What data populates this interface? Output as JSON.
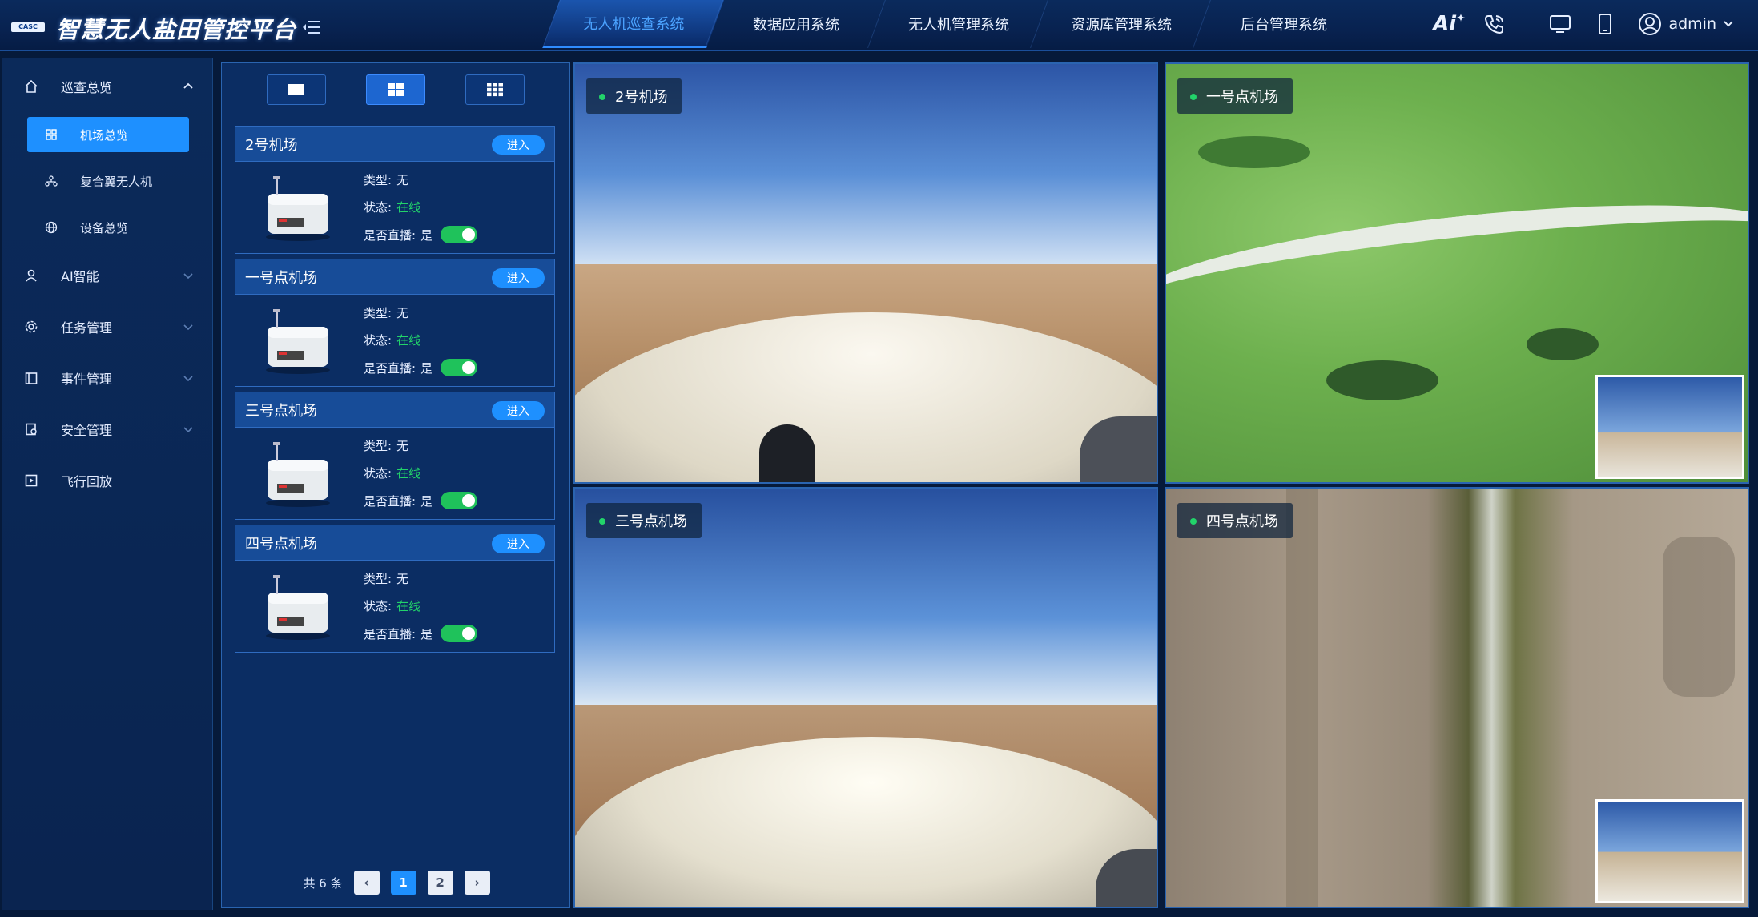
{
  "app": {
    "logo_text": "CASC",
    "title": "智慧无人盐田管控平台"
  },
  "nav": {
    "tabs": [
      {
        "label": "无人机巡查系统",
        "active": true
      },
      {
        "label": "数据应用系统",
        "active": false
      },
      {
        "label": "无人机管理系统",
        "active": false
      },
      {
        "label": "资源库管理系统",
        "active": false
      },
      {
        "label": "后台管理系统",
        "active": false
      }
    ]
  },
  "header": {
    "ai_label": "Ai",
    "user": "admin"
  },
  "sidebar": {
    "items": [
      {
        "label": "巡查总览",
        "icon": "home-icon",
        "expanded": true
      },
      {
        "label": "机场总览",
        "icon": "grid-icon",
        "active": true,
        "sub": true
      },
      {
        "label": "复合翼无人机",
        "icon": "nodes-icon",
        "sub": true
      },
      {
        "label": "设备总览",
        "icon": "globe-icon",
        "sub": true
      },
      {
        "label": "AI智能",
        "icon": "user-icon"
      },
      {
        "label": "任务管理",
        "icon": "gear-icon"
      },
      {
        "label": "事件管理",
        "icon": "calendar-icon"
      },
      {
        "label": "安全管理",
        "icon": "shield-doc-icon"
      },
      {
        "label": "飞行回放",
        "icon": "play-icon"
      }
    ]
  },
  "airports": {
    "enter_label": "进入",
    "type_label": "类型:",
    "status_label": "状态:",
    "live_label": "是否直播:",
    "list": [
      {
        "name": "2号机场",
        "type": "无",
        "status": "在线",
        "live": "是"
      },
      {
        "name": "一号点机场",
        "type": "无",
        "status": "在线",
        "live": "是"
      },
      {
        "name": "三号点机场",
        "type": "无",
        "status": "在线",
        "live": "是"
      },
      {
        "name": "四号点机场",
        "type": "无",
        "status": "在线",
        "live": "是"
      }
    ]
  },
  "pager": {
    "total": "共 6 条",
    "pages": [
      "1",
      "2"
    ],
    "current": "1",
    "prev": "‹",
    "next": "›"
  },
  "videos": [
    {
      "label": "2号机场"
    },
    {
      "label": "一号点机场"
    },
    {
      "label": "三号点机场"
    },
    {
      "label": "四号点机场"
    }
  ],
  "colors": {
    "accent": "#1e90ff",
    "online": "#22d36a",
    "bg": "#061a3a",
    "panel": "#0b2d63"
  }
}
